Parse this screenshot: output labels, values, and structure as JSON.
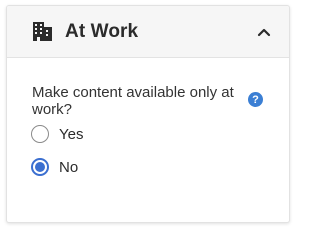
{
  "panel": {
    "title": "At Work",
    "icon": "building-icon",
    "expanded": true,
    "collapse_icon": "chevron-up-icon"
  },
  "setting": {
    "question": "Make content available only at work?",
    "help_symbol": "?",
    "options": [
      {
        "label": "Yes",
        "selected": false
      },
      {
        "label": "No",
        "selected": true
      }
    ]
  },
  "colors": {
    "accent": "#3b6fd0",
    "help_badge": "#3b7fd4",
    "header_bg": "#f6f6f6"
  }
}
